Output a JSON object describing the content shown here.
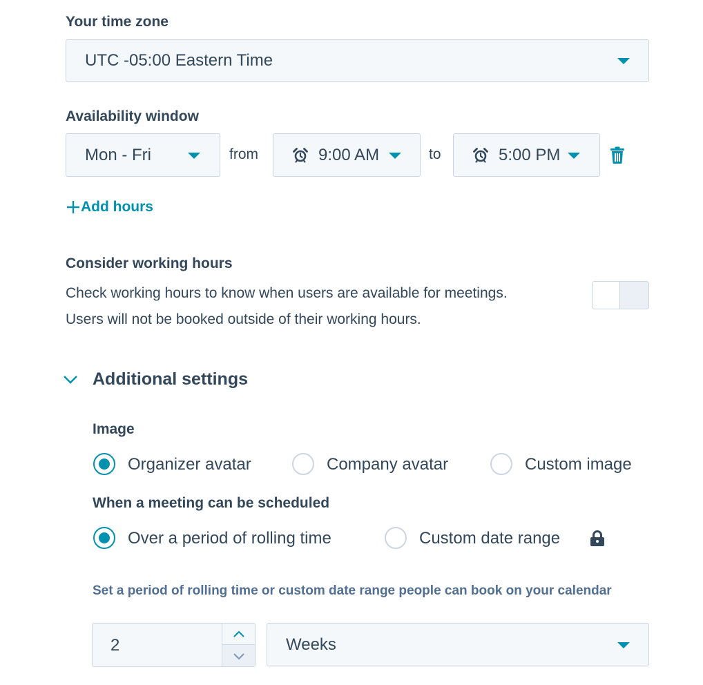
{
  "timezone": {
    "label": "Your time zone",
    "value": "UTC -05:00 Eastern Time"
  },
  "availability": {
    "label": "Availability window",
    "days": "Mon - Fri",
    "from_label": "from",
    "start_time": "9:00 AM",
    "to_label": "to",
    "end_time": "5:00 PM",
    "add_hours": "Add hours"
  },
  "working_hours": {
    "title": "Consider working hours",
    "line1": "Check working hours to know when users are available for meetings.",
    "line2": "Users will not be booked outside of their working hours.",
    "toggle_on": false
  },
  "additional": {
    "title": "Additional settings",
    "image": {
      "label": "Image",
      "options": [
        "Organizer avatar",
        "Company avatar",
        "Custom image"
      ],
      "selected": "Organizer avatar"
    },
    "schedule": {
      "label": "When a meeting can be scheduled",
      "options": [
        "Over a period of rolling time",
        "Custom date range"
      ],
      "selected": "Over a period of rolling time"
    },
    "period": {
      "help": "Set a period of rolling time or custom date range people can book on your calendar",
      "amount": "2",
      "unit": "Weeks"
    }
  },
  "colors": {
    "accent": "#0091ae",
    "text": "#33475b",
    "border": "#cbd6e2",
    "field_bg": "#f5f8fa"
  }
}
